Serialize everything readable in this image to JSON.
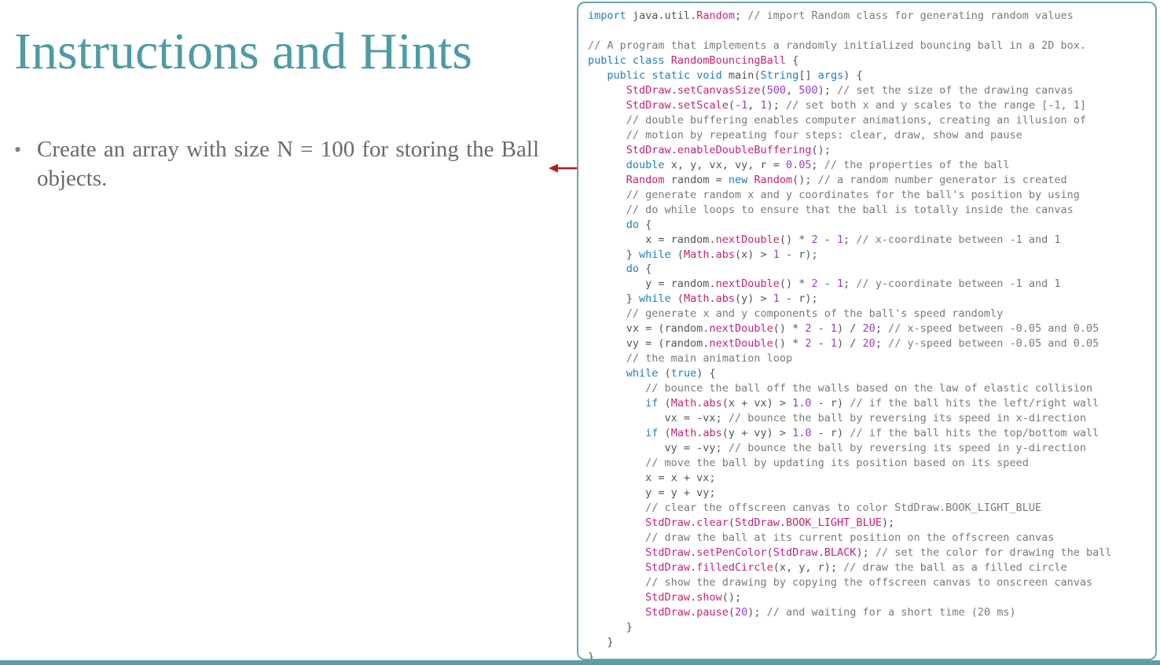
{
  "slide": {
    "title": "Instructions and Hints",
    "bullets": [
      "Create an array with size N = 100 for storing the Ball objects."
    ]
  },
  "colors": {
    "title": "#4e9ba4",
    "arrow": "#b31c1c",
    "panel_border": "#6aa4ab",
    "bottom_rule": "#5d9ca4"
  },
  "icons": {
    "bullet": "bullet-dot",
    "arrow": "left-arrow"
  },
  "code_lines": [
    {
      "indent": 0,
      "code": "import java.util.Random;",
      "comment": "// import Random class for generating random values"
    },
    {
      "indent": 0,
      "code": "",
      "comment": ""
    },
    {
      "indent": 0,
      "code": "",
      "comment": "// A program that implements a randomly initialized bouncing ball in a 2D box."
    },
    {
      "indent": 0,
      "code": "public class RandomBouncingBall {",
      "comment": ""
    },
    {
      "indent": 1,
      "code": "public static void main(String[] args) {",
      "comment": ""
    },
    {
      "indent": 2,
      "code": "StdDraw.setCanvasSize(500, 500);",
      "comment": "// set the size of the drawing canvas"
    },
    {
      "indent": 2,
      "code": "StdDraw.setScale(-1, 1);",
      "comment": "// set both x and y scales to the range [-1, 1]"
    },
    {
      "indent": 2,
      "code": "",
      "comment": "// double buffering enables computer animations, creating an illusion of"
    },
    {
      "indent": 2,
      "code": "",
      "comment": "// motion by repeating four steps: clear, draw, show and pause"
    },
    {
      "indent": 2,
      "code": "StdDraw.enableDoubleBuffering();",
      "comment": ""
    },
    {
      "indent": 2,
      "code": "double x, y, vx, vy, r = 0.05;",
      "comment": "// the properties of the ball"
    },
    {
      "indent": 2,
      "code": "Random random = new Random();",
      "comment": "// a random number generator is created"
    },
    {
      "indent": 2,
      "code": "",
      "comment": "// generate random x and y coordinates for the ball's position by using"
    },
    {
      "indent": 2,
      "code": "",
      "comment": "// do while loops to ensure that the ball is totally inside the canvas"
    },
    {
      "indent": 2,
      "code": "do {",
      "comment": ""
    },
    {
      "indent": 3,
      "code": "x = random.nextDouble() * 2 - 1;",
      "comment": "// x-coordinate between -1 and 1"
    },
    {
      "indent": 2,
      "code": "} while (Math.abs(x) > 1 - r);",
      "comment": ""
    },
    {
      "indent": 2,
      "code": "do {",
      "comment": ""
    },
    {
      "indent": 3,
      "code": "y = random.nextDouble() * 2 - 1;",
      "comment": "// y-coordinate between -1 and 1"
    },
    {
      "indent": 2,
      "code": "} while (Math.abs(y) > 1 - r);",
      "comment": ""
    },
    {
      "indent": 2,
      "code": "",
      "comment": "// generate x and y components of the ball's speed randomly"
    },
    {
      "indent": 2,
      "code": "vx = (random.nextDouble() * 2 - 1) / 20;",
      "comment": "// x-speed between -0.05 and 0.05"
    },
    {
      "indent": 2,
      "code": "vy = (random.nextDouble() * 2 - 1) / 20;",
      "comment": "// y-speed between -0.05 and 0.05"
    },
    {
      "indent": 2,
      "code": "",
      "comment": "// the main animation loop"
    },
    {
      "indent": 2,
      "code": "while (true) {",
      "comment": ""
    },
    {
      "indent": 3,
      "code": "",
      "comment": "// bounce the ball off the walls based on the law of elastic collision"
    },
    {
      "indent": 3,
      "code": "if (Math.abs(x + vx) > 1.0 - r)",
      "comment": "// if the ball hits the left/right wall"
    },
    {
      "indent": 4,
      "code": "vx = -vx;",
      "comment": "// bounce the ball by reversing its speed in x-direction"
    },
    {
      "indent": 3,
      "code": "if (Math.abs(y + vy) > 1.0 - r)",
      "comment": "// if the ball hits the top/bottom wall"
    },
    {
      "indent": 4,
      "code": "vy = -vy;",
      "comment": "// bounce the ball by reversing its speed in y-direction"
    },
    {
      "indent": 3,
      "code": "",
      "comment": "// move the ball by updating its position based on its speed"
    },
    {
      "indent": 3,
      "code": "x = x + vx;",
      "comment": ""
    },
    {
      "indent": 3,
      "code": "y = y + vy;",
      "comment": ""
    },
    {
      "indent": 3,
      "code": "",
      "comment": "// clear the offscreen canvas to color StdDraw.BOOK_LIGHT_BLUE"
    },
    {
      "indent": 3,
      "code": "StdDraw.clear(StdDraw.BOOK_LIGHT_BLUE);",
      "comment": ""
    },
    {
      "indent": 3,
      "code": "",
      "comment": "// draw the ball at its current position on the offscreen canvas"
    },
    {
      "indent": 3,
      "code": "StdDraw.setPenColor(StdDraw.BLACK);",
      "comment": "// set the color for drawing the ball"
    },
    {
      "indent": 3,
      "code": "StdDraw.filledCircle(x, y, r);",
      "comment": "// draw the ball as a filled circle"
    },
    {
      "indent": 3,
      "code": "",
      "comment": "// show the drawing by copying the offscreen canvas to onscreen canvas"
    },
    {
      "indent": 3,
      "code": "StdDraw.show();",
      "comment": ""
    },
    {
      "indent": 3,
      "code": "StdDraw.pause(20);",
      "comment": "// and waiting for a short time (20 ms)"
    },
    {
      "indent": 2,
      "code": "}",
      "comment": ""
    },
    {
      "indent": 1,
      "code": "}",
      "comment": ""
    },
    {
      "indent": 0,
      "code": "}",
      "comment": ""
    }
  ]
}
